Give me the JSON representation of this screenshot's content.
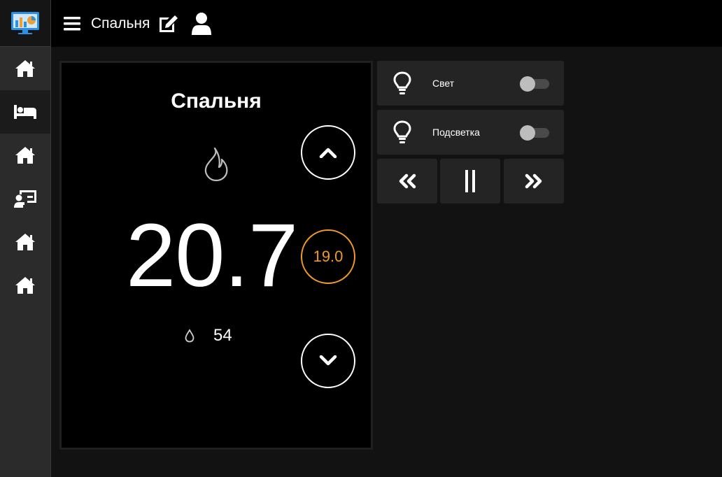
{
  "header": {
    "title": "Спальня",
    "menu_icon": "hamburger-icon",
    "edit_icon": "edit-icon",
    "user_icon": "user-icon"
  },
  "sidebar": {
    "logo_icon": "dashboard-monitor-icon",
    "items": [
      {
        "icon": "home-icon",
        "active": false
      },
      {
        "icon": "bed-icon",
        "active": true
      },
      {
        "icon": "home-icon",
        "active": false
      },
      {
        "icon": "presentation-user-icon",
        "active": false
      },
      {
        "icon": "home-icon",
        "active": false
      },
      {
        "icon": "home-icon",
        "active": false
      }
    ]
  },
  "thermostat": {
    "title": "Спальня",
    "current_temp": "20.7",
    "setpoint": "19.0",
    "humidity": "54",
    "mode_icon": "flame-icon",
    "humidity_icon": "water-drop-icon"
  },
  "switches": [
    {
      "label": "Свет",
      "icon": "lightbulb-icon",
      "on": false
    },
    {
      "label": "Подсветка",
      "icon": "lightbulb-icon",
      "on": false
    }
  ],
  "media": {
    "prev_icon": "rewind-icon",
    "pause_icon": "pause-icon",
    "next_icon": "fast-forward-icon"
  },
  "colors": {
    "accent_setpoint": "#f09a2a",
    "background": "#121212",
    "card": "#242424",
    "sidebar": "#2b2b2b"
  }
}
